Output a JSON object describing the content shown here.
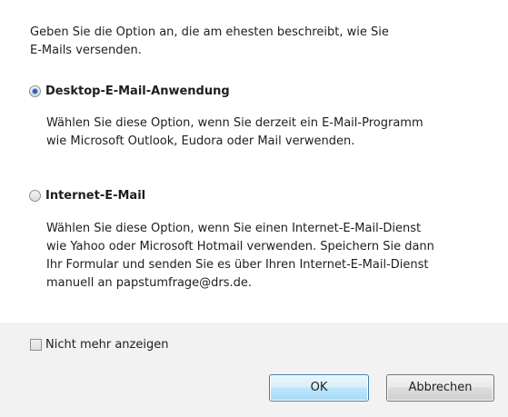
{
  "intro_text": "Geben Sie die Option an, die am ehesten beschreibt, wie Sie\nE-Mails versenden.",
  "options": [
    {
      "label": "Desktop-E-Mail-Anwendung",
      "selected": true,
      "description": "Wählen Sie diese Option, wenn Sie derzeit ein E-Mail-Programm\nwie Microsoft Outlook, Eudora oder Mail verwenden."
    },
    {
      "label": "Internet-E-Mail",
      "selected": false,
      "description": "Wählen Sie diese Option, wenn Sie einen Internet-E-Mail-Dienst\nwie Yahoo oder Microsoft Hotmail verwenden. Speichern Sie dann\nIhr Formular und senden Sie es über Ihren Internet-E-Mail-Dienst\nmanuell an papstumfrage@drs.de."
    }
  ],
  "dont_show_again": {
    "label": "Nicht mehr anzeigen",
    "checked": false
  },
  "buttons": {
    "ok_label": "OK",
    "cancel_label": "Abbrechen"
  }
}
